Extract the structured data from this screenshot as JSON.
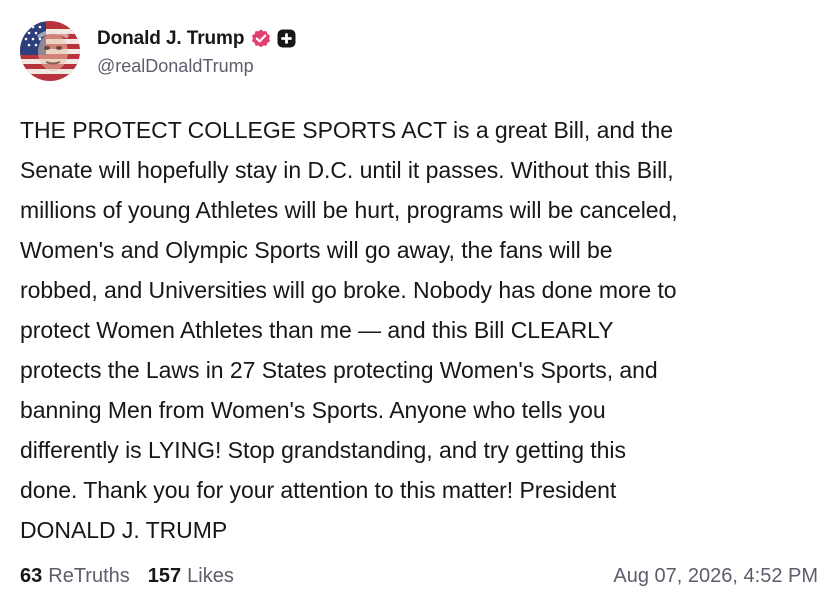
{
  "author": {
    "display_name": "Donald J. Trump",
    "handle": "@realDonaldTrump",
    "avatar_icon": "flag-portrait-avatar",
    "verified_icon": "verified-badge-icon",
    "verified_color": "#e13f6d",
    "plus_icon": "plus-badge-icon"
  },
  "post": {
    "text": "THE PROTECT COLLEGE SPORTS ACT is a great Bill, and the\nSenate will hopefully stay in D.C. until it passes. Without this Bill,\nmillions of young Athletes will be hurt, programs will be canceled,\nWomen's and Olympic Sports will go away, the fans will be\nrobbed, and Universities will go broke. Nobody has done more to\nprotect Women Athletes than me — and this Bill CLEARLY\nprotects the Laws in 27 States protecting Women's Sports, and\nbanning Men from Women's Sports. Anyone who tells you\ndifferently is LYING! Stop grandstanding, and try getting this\ndone. Thank you for your attention to this matter! President\nDONALD J. TRUMP"
  },
  "footer": {
    "retruths_count": "63",
    "retruths_label": "ReTruths",
    "likes_count": "157",
    "likes_label": "Likes",
    "timestamp": "Aug 07, 2026, 4:52 PM"
  }
}
